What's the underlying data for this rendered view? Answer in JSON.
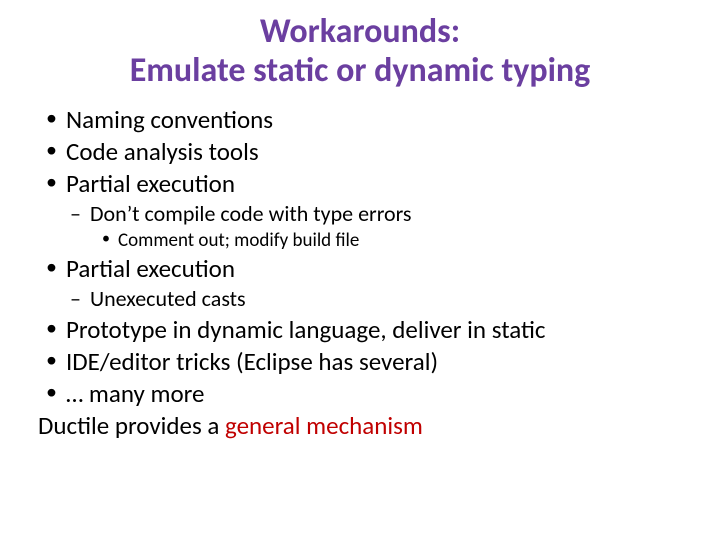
{
  "title": {
    "line1": "Workarounds:",
    "line2": "Emulate static or dynamic typing"
  },
  "bullets": {
    "b1": "Naming conventions",
    "b2": "Code analysis tools",
    "b3": "Partial execution",
    "b3_1": "Don’t compile code with type errors",
    "b3_1_1": "Comment out; modify build file",
    "b4": "Partial execution",
    "b4_1": "Unexecuted casts",
    "b5": "Prototype in dynamic language, deliver in static",
    "b6": "IDE/editor tricks (Eclipse has several)",
    "b7": "… many more"
  },
  "closing": {
    "pre": "Ductile provides a ",
    "hl": "general mechanism"
  }
}
